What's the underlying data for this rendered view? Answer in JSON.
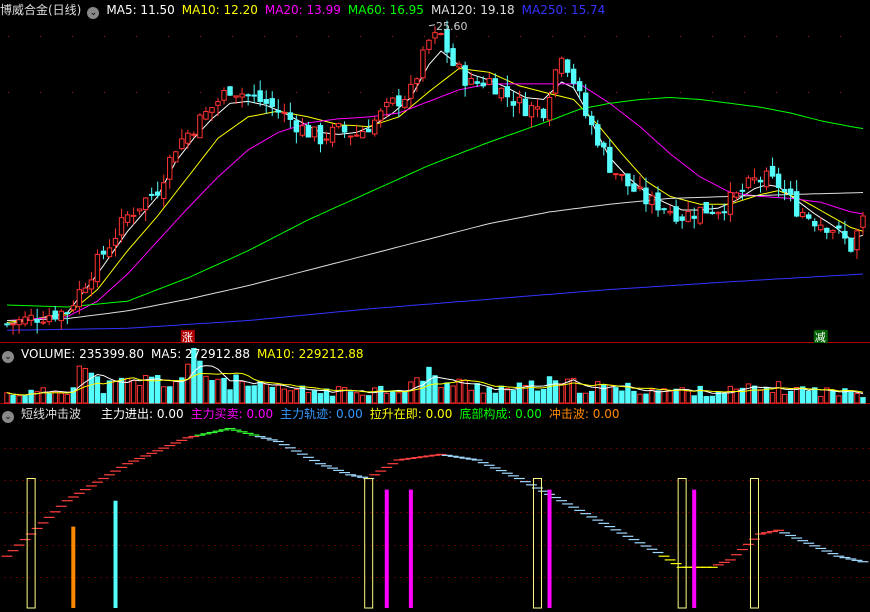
{
  "price_panel": {
    "title": "博威合金(日线)",
    "ma_labels": [
      {
        "text": "MA5: 11.50",
        "color": "#ffffff"
      },
      {
        "text": "MA10: 12.20",
        "color": "#ffff00"
      },
      {
        "text": "MA20: 13.99",
        "color": "#ff00ff"
      },
      {
        "text": "MA60: 16.95",
        "color": "#00ff00"
      },
      {
        "text": "MA120: 19.18",
        "color": "#dddddd"
      },
      {
        "text": "MA250: 15.74",
        "color": "#3333ff"
      }
    ],
    "peak_label": "25.60",
    "signal_up": "涨",
    "signal_down": "减"
  },
  "volume_panel": {
    "labels": [
      {
        "text": "VOLUME: 235399.80",
        "color": "#ffffff"
      },
      {
        "text": "MA5: 272912.88",
        "color": "#ffffff"
      },
      {
        "text": "MA10: 229212.88",
        "color": "#ffff00"
      }
    ]
  },
  "indicator_panel": {
    "title": "短线冲击波",
    "labels": [
      {
        "text": "主力进出: 0.00",
        "color": "#ffffff"
      },
      {
        "text": "主力买卖: 0.00",
        "color": "#ff00ff"
      },
      {
        "text": "主力轨迹: 0.00",
        "color": "#3399ff"
      },
      {
        "text": "拉升在即: 0.00",
        "color": "#ffff00"
      },
      {
        "text": "底部构成: 0.00",
        "color": "#00ff00"
      },
      {
        "text": "冲击波: 0.00",
        "color": "#ff8800"
      }
    ]
  },
  "colors": {
    "up": "#ff3232",
    "down": "#54fcfc",
    "bg": "#000000",
    "grid": "#8b0000"
  },
  "chart_data": [
    {
      "type": "candlestick",
      "title": "博威合金(日线)",
      "x_count": 143,
      "y_range": [
        9.5,
        26.0
      ],
      "pivots": [
        [
          0,
          10.2
        ],
        [
          5,
          10.6
        ],
        [
          10,
          10.9
        ],
        [
          15,
          13.4
        ],
        [
          20,
          15.8
        ],
        [
          25,
          17.2
        ],
        [
          28,
          19.4
        ],
        [
          31,
          20.4
        ],
        [
          34,
          21.4
        ],
        [
          37,
          22.4
        ],
        [
          40,
          22.0
        ],
        [
          43,
          21.6
        ],
        [
          46,
          21.0
        ],
        [
          49,
          20.3
        ],
        [
          52,
          19.8
        ],
        [
          55,
          20.2
        ],
        [
          58,
          20.0
        ],
        [
          61,
          20.7
        ],
        [
          64,
          21.6
        ],
        [
          67,
          22.2
        ],
        [
          70,
          24.8
        ],
        [
          72,
          25.1
        ],
        [
          74,
          23.6
        ],
        [
          77,
          22.6
        ],
        [
          80,
          22.8
        ],
        [
          83,
          22.0
        ],
        [
          86,
          21.4
        ],
        [
          89,
          21.3
        ],
        [
          92,
          24.3
        ],
        [
          94,
          22.8
        ],
        [
          96,
          21.0
        ],
        [
          98,
          19.8
        ],
        [
          100,
          18.4
        ],
        [
          103,
          17.4
        ],
        [
          106,
          16.6
        ],
        [
          109,
          16.3
        ],
        [
          112,
          15.8
        ],
        [
          115,
          16.1
        ],
        [
          118,
          16.2
        ],
        [
          121,
          16.8
        ],
        [
          124,
          17.6
        ],
        [
          126,
          17.7
        ],
        [
          128,
          17.4
        ],
        [
          131,
          16.2
        ],
        [
          134,
          15.6
        ],
        [
          137,
          15.2
        ],
        [
          140,
          14.2
        ],
        [
          142,
          15.6
        ]
      ],
      "moving_averages": [
        {
          "name": "MA5",
          "pivots": [
            [
              0,
              10.2
            ],
            [
              5,
              10.5
            ],
            [
              10,
              10.8
            ],
            [
              15,
              12.8
            ],
            [
              20,
              15.0
            ],
            [
              25,
              16.8
            ],
            [
              28,
              18.6
            ],
            [
              31,
              19.8
            ],
            [
              34,
              20.8
            ],
            [
              37,
              21.6
            ],
            [
              40,
              21.7
            ],
            [
              43,
              21.5
            ],
            [
              46,
              21.1
            ],
            [
              49,
              20.6
            ],
            [
              52,
              20.1
            ],
            [
              55,
              20.0
            ],
            [
              58,
              20.1
            ],
            [
              61,
              20.5
            ],
            [
              64,
              21.1
            ],
            [
              67,
              21.9
            ],
            [
              70,
              23.6
            ],
            [
              72,
              24.3
            ],
            [
              74,
              23.8
            ],
            [
              77,
              23.1
            ],
            [
              80,
              22.8
            ],
            [
              83,
              22.4
            ],
            [
              86,
              21.9
            ],
            [
              89,
              21.8
            ],
            [
              92,
              22.7
            ],
            [
              94,
              22.4
            ],
            [
              96,
              21.3
            ],
            [
              98,
              20.0
            ],
            [
              100,
              18.8
            ],
            [
              103,
              17.8
            ],
            [
              106,
              17.0
            ],
            [
              109,
              16.5
            ],
            [
              112,
              16.1
            ],
            [
              115,
              16.1
            ],
            [
              118,
              16.2
            ],
            [
              121,
              16.6
            ],
            [
              124,
              17.2
            ],
            [
              126,
              17.4
            ],
            [
              128,
              17.3
            ],
            [
              131,
              16.6
            ],
            [
              134,
              15.9
            ],
            [
              137,
              15.3
            ],
            [
              140,
              14.6
            ],
            [
              142,
              14.8
            ]
          ]
        },
        {
          "name": "MA10",
          "pivots": [
            [
              0,
              10.3
            ],
            [
              10,
              10.7
            ],
            [
              15,
              12.0
            ],
            [
              20,
              14.0
            ],
            [
              25,
              15.8
            ],
            [
              30,
              17.8
            ],
            [
              35,
              19.8
            ],
            [
              40,
              20.9
            ],
            [
              45,
              21.2
            ],
            [
              50,
              20.9
            ],
            [
              55,
              20.5
            ],
            [
              60,
              20.4
            ],
            [
              65,
              20.9
            ],
            [
              70,
              22.2
            ],
            [
              75,
              23.4
            ],
            [
              80,
              23.2
            ],
            [
              85,
              22.5
            ],
            [
              90,
              22.1
            ],
            [
              94,
              21.8
            ],
            [
              98,
              20.5
            ],
            [
              102,
              19.0
            ],
            [
              106,
              17.6
            ],
            [
              110,
              16.8
            ],
            [
              115,
              16.4
            ],
            [
              120,
              16.4
            ],
            [
              125,
              16.9
            ],
            [
              128,
              17.1
            ],
            [
              132,
              16.6
            ],
            [
              136,
              15.9
            ],
            [
              140,
              15.2
            ],
            [
              142,
              15.0
            ]
          ]
        },
        {
          "name": "MA20",
          "pivots": [
            [
              0,
              10.4
            ],
            [
              10,
              10.6
            ],
            [
              15,
              11.4
            ],
            [
              20,
              12.8
            ],
            [
              25,
              14.5
            ],
            [
              30,
              16.2
            ],
            [
              35,
              17.8
            ],
            [
              40,
              19.2
            ],
            [
              45,
              20.1
            ],
            [
              50,
              20.6
            ],
            [
              55,
              20.8
            ],
            [
              60,
              20.9
            ],
            [
              65,
              21.1
            ],
            [
              70,
              21.7
            ],
            [
              75,
              22.3
            ],
            [
              80,
              22.6
            ],
            [
              85,
              22.6
            ],
            [
              90,
              22.6
            ],
            [
              95,
              22.6
            ],
            [
              100,
              21.6
            ],
            [
              105,
              20.4
            ],
            [
              110,
              19.0
            ],
            [
              115,
              17.8
            ],
            [
              120,
              17.0
            ],
            [
              125,
              16.8
            ],
            [
              130,
              16.7
            ],
            [
              135,
              16.5
            ],
            [
              140,
              16.0
            ],
            [
              142,
              15.9
            ]
          ]
        },
        {
          "name": "MA60",
          "pivots": [
            [
              0,
              11.2
            ],
            [
              10,
              11.1
            ],
            [
              20,
              11.4
            ],
            [
              30,
              12.6
            ],
            [
              40,
              14.0
            ],
            [
              50,
              15.6
            ],
            [
              60,
              17.0
            ],
            [
              70,
              18.4
            ],
            [
              80,
              19.6
            ],
            [
              90,
              20.7
            ],
            [
              95,
              21.3
            ],
            [
              100,
              21.6
            ],
            [
              105,
              21.8
            ],
            [
              110,
              21.9
            ],
            [
              115,
              21.8
            ],
            [
              120,
              21.6
            ],
            [
              125,
              21.4
            ],
            [
              130,
              21.1
            ],
            [
              135,
              20.7
            ],
            [
              140,
              20.4
            ],
            [
              142,
              20.3
            ]
          ]
        },
        {
          "name": "MA120",
          "pivots": [
            [
              0,
              10.4
            ],
            [
              10,
              10.5
            ],
            [
              20,
              10.9
            ],
            [
              30,
              11.5
            ],
            [
              40,
              12.2
            ],
            [
              50,
              13.0
            ],
            [
              60,
              13.8
            ],
            [
              70,
              14.6
            ],
            [
              80,
              15.4
            ],
            [
              90,
              16.0
            ],
            [
              100,
              16.4
            ],
            [
              110,
              16.7
            ],
            [
              120,
              16.8
            ],
            [
              130,
              16.9
            ],
            [
              142,
              17.0
            ]
          ]
        },
        {
          "name": "MA250",
          "pivots": [
            [
              0,
              9.9
            ],
            [
              20,
              10.0
            ],
            [
              40,
              10.4
            ],
            [
              60,
              11.0
            ],
            [
              80,
              11.5
            ],
            [
              100,
              12.0
            ],
            [
              120,
              12.4
            ],
            [
              142,
              12.8
            ]
          ]
        }
      ],
      "annotations": [
        {
          "index": 71,
          "text": "25.60"
        },
        {
          "index": 30,
          "text": "涨"
        },
        {
          "index": 135,
          "text": "减"
        }
      ]
    },
    {
      "type": "bar",
      "title": "VOLUME",
      "x_count": 143,
      "y_range": [
        0,
        1000000
      ],
      "pivots": [
        [
          0,
          220000
        ],
        [
          5,
          250000
        ],
        [
          10,
          320000
        ],
        [
          12,
          950000
        ],
        [
          14,
          600000
        ],
        [
          16,
          380000
        ],
        [
          20,
          480000
        ],
        [
          24,
          560000
        ],
        [
          28,
          520000
        ],
        [
          31,
          960000
        ],
        [
          34,
          640000
        ],
        [
          38,
          480000
        ],
        [
          42,
          360000
        ],
        [
          46,
          320000
        ],
        [
          50,
          290000
        ],
        [
          55,
          280000
        ],
        [
          60,
          320000
        ],
        [
          65,
          360000
        ],
        [
          70,
          640000
        ],
        [
          73,
          480000
        ],
        [
          78,
          400000
        ],
        [
          84,
          330000
        ],
        [
          90,
          450000
        ],
        [
          94,
          420000
        ],
        [
          100,
          360000
        ],
        [
          106,
          330000
        ],
        [
          112,
          290000
        ],
        [
          118,
          280000
        ],
        [
          124,
          340000
        ],
        [
          128,
          360000
        ],
        [
          134,
          300000
        ],
        [
          140,
          240000
        ],
        [
          142,
          235400
        ]
      ],
      "moving_averages": [
        {
          "name": "MA5",
          "value": 272912.88
        },
        {
          "name": "MA10",
          "value": 229212.88
        }
      ]
    },
    {
      "type": "indicator",
      "title": "短线冲击波",
      "y_range": [
        0,
        100
      ],
      "wave_pivots": [
        [
          0,
          28
        ],
        [
          10,
          58
        ],
        [
          20,
          78
        ],
        [
          30,
          92
        ],
        [
          37,
          97
        ],
        [
          45,
          90
        ],
        [
          52,
          78
        ],
        [
          57,
          72
        ],
        [
          60,
          70
        ],
        [
          65,
          80
        ],
        [
          72,
          83
        ],
        [
          78,
          80
        ],
        [
          85,
          70
        ],
        [
          92,
          58
        ],
        [
          100,
          44
        ],
        [
          108,
          30
        ],
        [
          112,
          22
        ],
        [
          117,
          22
        ],
        [
          120,
          26
        ],
        [
          125,
          40
        ],
        [
          128,
          42
        ],
        [
          133,
          35
        ],
        [
          138,
          28
        ],
        [
          142,
          25
        ]
      ],
      "vertical_bars": [
        {
          "index": 11,
          "value": 44,
          "color": "#ff8800"
        },
        {
          "index": 18,
          "value": 58,
          "color": "#54fcfc"
        },
        {
          "index": 63,
          "value": 64,
          "color": "#ff00ff"
        },
        {
          "index": 67,
          "value": 64,
          "color": "#ff00ff"
        },
        {
          "index": 90,
          "value": 64,
          "color": "#ff00ff"
        },
        {
          "index": 114,
          "value": 64,
          "color": "#ff00ff"
        }
      ],
      "boxes": [
        {
          "index": 4,
          "value": 70
        },
        {
          "index": 60,
          "value": 70
        },
        {
          "index": 88,
          "value": 70
        },
        {
          "index": 112,
          "value": 70
        },
        {
          "index": 124,
          "value": 70
        }
      ]
    }
  ]
}
